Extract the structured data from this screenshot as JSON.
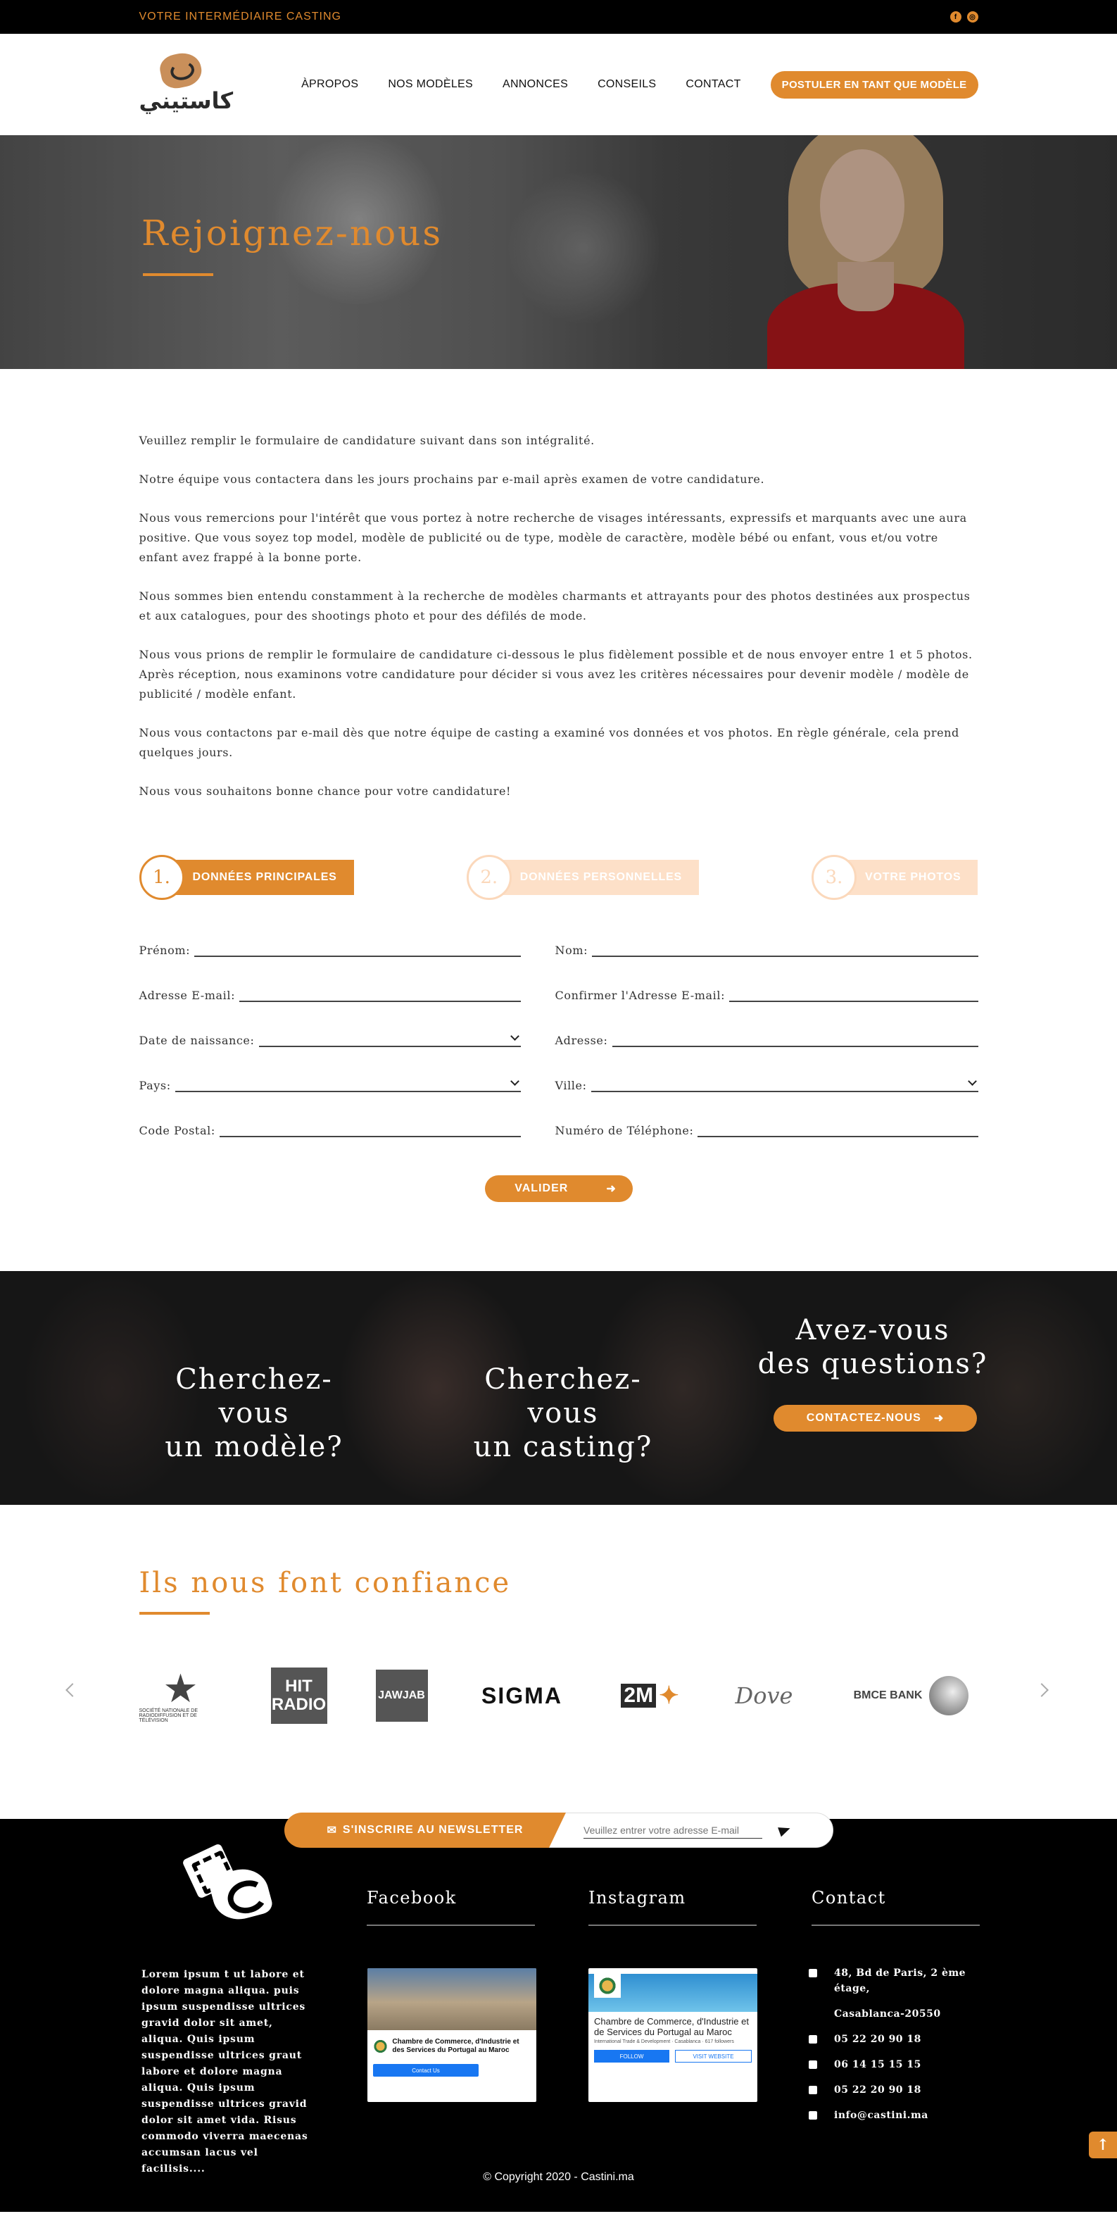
{
  "topbar": {
    "tagline": "VOTRE INTERMÉDIAIRE CASTING",
    "social": [
      "facebook-icon",
      "instagram-icon"
    ]
  },
  "header": {
    "logo_text": "كاستيني",
    "nav": [
      "ÀPROPOS",
      "NOS MODÈLES",
      "ANNONCES",
      "CONSEILS",
      "CONTACT"
    ],
    "cta": "POSTULER EN TANT QUE MODÈLE"
  },
  "hero": {
    "title": "Rejoignez-nous"
  },
  "intro": {
    "paragraphs": [
      "Veuillez remplir le formulaire de candidature suivant dans son intégralité.",
      "Notre équipe vous contactera dans les jours prochains par e-mail après examen de votre candidature.",
      "Nous vous remercions pour l'intérêt que vous portez à notre recherche de visages intéressants, expressifs et marquants avec une aura positive. Que vous soyez top model, modèle de publicité ou de type, modèle de caractère, modèle bébé ou enfant, vous et/ou votre enfant avez frappé à la bonne porte.",
      "Nous sommes bien entendu constamment à la recherche de modèles charmants et attrayants pour des photos destinées aux prospectus et aux catalogues, pour des shootings photo et pour des défilés de mode.",
      "Nous vous prions de remplir le formulaire de candidature ci-dessous le plus fidèlement possible et de nous envoyer entre 1 et 5 photos. Après réception, nous examinons votre candidature pour décider si vous avez les critères nécessaires pour devenir modèle / modèle de publicité / modèle enfant.",
      "Nous vous contactons par e-mail dès que notre équipe de casting a examiné vos données et vos photos. En règle générale, cela prend quelques jours.",
      "Nous vous souhaitons bonne chance pour votre candidature!"
    ]
  },
  "steps": [
    {
      "num": "1.",
      "label": "DONNÉES PRINCIPALES"
    },
    {
      "num": "2.",
      "label": "DONNÉES PERSONNELLES"
    },
    {
      "num": "3.",
      "label": "VOTRE PHOTOS"
    }
  ],
  "form": {
    "fields": [
      {
        "label": "Prénom:"
      },
      {
        "label": "Nom:"
      },
      {
        "label": "Adresse E-mail:"
      },
      {
        "label": "Confirmer l'Adresse E-mail:"
      },
      {
        "label": "Date de naissance:"
      },
      {
        "label": "Adresse:"
      },
      {
        "label": "Pays:"
      },
      {
        "label": "Ville:"
      },
      {
        "label": "Code Postal:"
      },
      {
        "label": "Numéro de Téléphone:"
      }
    ],
    "submit": "VALIDER"
  },
  "band": {
    "col1": [
      "Cherchez-vous",
      "un modèle?"
    ],
    "col2": [
      "Cherchez-vous",
      "un casting?"
    ],
    "col3": [
      "Avez-vous",
      "des questions?"
    ],
    "contact_btn": "CONTACTEZ-NOUS"
  },
  "partners": {
    "title": "Ils nous font confiance",
    "logos": {
      "snrt_sub": "SOCIÉTÉ NATIONALE DE RADIODIFFUSION ET DE TÉLÉVISION",
      "hit_top": "HIT",
      "hit_bottom": "RADIO",
      "jawjab": "JAWJAB",
      "sigma": "SIGMA",
      "twom": "2M",
      "dove": "Dove",
      "bmce": "BMCE BANK"
    }
  },
  "newsletter": {
    "label": "S'INSCRIRE AU NEWSLETTER",
    "placeholder": "Veuillez entrer votre adresse E-mail"
  },
  "footer": {
    "lorem": "Lorem ipsum t ut labore et dolore magna aliqua. puis ipsum suspendisse ultrices gravid dolor sit amet, aliqua. Quis ipsum suspendisse ultrices graut labore et dolore magna aliqua. Quis ipsum suspendisse ultrices gravid dolor sit amet vida. Risus commodo viverra maecenas accumsan lacus vel facilisis....",
    "facebook": {
      "title": "Facebook",
      "org": "Chambre de Commerce, d'Industrie et des Services du Portugal au Maroc",
      "btn": "Contact Us"
    },
    "instagram": {
      "title": "Instagram",
      "org": "Chambre de Commerce, d'Industrie et de Services du Portugal au Maroc",
      "meta": "International Trade & Development · Casablanca · 617 followers",
      "follow": "FOLLOW",
      "visit": "VISIT WEBSITE"
    },
    "contact": {
      "title": "Contact",
      "address1": "48, Bd de Paris, 2 ème étage,",
      "address2": "Casablanca-20550",
      "phone": "05 22 20 90 18",
      "mobile": "06 14 15 15 15",
      "fax": "05 22 20 90 18",
      "email": "info@castini.ma"
    },
    "copyright": "© Copyright 2020 - Castini.ma"
  },
  "colors": {
    "accent": "#e08a2e",
    "dark": "#000000"
  }
}
